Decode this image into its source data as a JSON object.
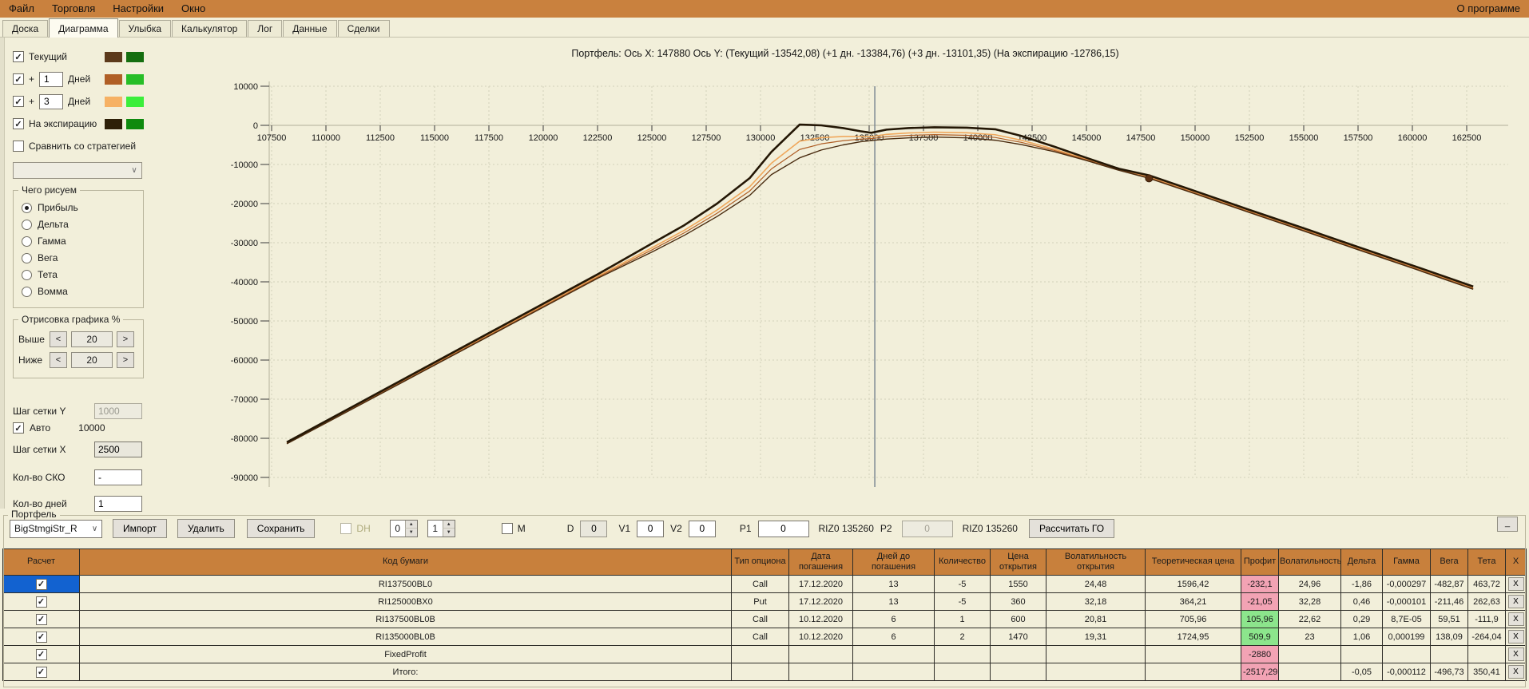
{
  "menu": {
    "items": [
      "Файл",
      "Торговля",
      "Настройки",
      "Окно"
    ],
    "about": "О программе"
  },
  "tabs": [
    "Доска",
    "Диаграмма",
    "Улыбка",
    "Калькулятор",
    "Лог",
    "Данные",
    "Сделки"
  ],
  "active_tab": "Диаграмма",
  "sidebar": {
    "plus_label": "+",
    "series_toggles": [
      {
        "label": "Текущий",
        "value": "",
        "swatch1": "#5C3A1B",
        "swatch2": "#156E0F"
      },
      {
        "label": "Дней",
        "value": "1",
        "swatch1": "#B05F26",
        "swatch2": "#27BE27"
      },
      {
        "label": "Дней",
        "value": "3",
        "swatch1": "#F6B164",
        "swatch2": "#3BEE3B"
      },
      {
        "label": "На экспирацию",
        "value": "",
        "swatch1": "#2E2008",
        "swatch2": "#0E8A0E"
      }
    ],
    "compare_label": "Сравнить со стратегией",
    "draw_group": {
      "title": "Чего рисуем",
      "options": [
        "Прибыль",
        "Дельта",
        "Гамма",
        "Вега",
        "Тета",
        "Вомма"
      ],
      "selected": "Прибыль"
    },
    "render_group": {
      "title": "Отрисовка графика %",
      "above_label": "Выше",
      "above": "20",
      "below_label": "Ниже",
      "below": "20",
      "dec": "<",
      "inc": ">"
    },
    "grid_y_label": "Шаг сетки Y",
    "grid_y": "1000",
    "auto_label": "Авто",
    "auto_value": "10000",
    "grid_x_label": "Шаг сетки X",
    "grid_x": "2500",
    "sko_label": "Кол-во СКО",
    "sko": "-",
    "days_label": "Кол-во дней",
    "days": "1"
  },
  "chart_data": {
    "type": "line",
    "title": "Портфель: Ось X: 147880 Ось Y:   (Текущий -13542,08)  (+1 дн. -13384,76)  (+3 дн. -13101,35)  (На экспирацию -12786,15)",
    "x_ticks": [
      107500,
      110000,
      112500,
      115000,
      117500,
      120000,
      122500,
      125000,
      127500,
      130000,
      132500,
      135000,
      137500,
      140000,
      142500,
      145000,
      147500,
      150000,
      152500,
      155000,
      157500,
      160000,
      162500
    ],
    "y_ticks": [
      10000,
      0,
      -10000,
      -20000,
      -30000,
      -40000,
      -50000,
      -60000,
      -70000,
      -80000,
      -90000
    ],
    "x_grid_step": 2500,
    "y_grid_step": 10000,
    "grid": true,
    "legend": false,
    "vline_x": 135260,
    "marker": {
      "x": 147880,
      "y": -13542
    },
    "x": [
      108200,
      110000,
      112500,
      115000,
      117500,
      120000,
      122500,
      125000,
      126500,
      128000,
      129500,
      130500,
      131800,
      132800,
      133800,
      134600,
      135100,
      135800,
      136800,
      138000,
      139500,
      140800,
      142000,
      143500,
      145000,
      146500,
      147880,
      150000,
      152500,
      155000,
      157500,
      160000,
      162800
    ],
    "series": [
      {
        "id": "plus3",
        "name": "+3 дн",
        "color": "#F0A85C",
        "width": 1.6,
        "y": [
          -81200,
          -75850,
          -68400,
          -60950,
          -53500,
          -46050,
          -38600,
          -31300,
          -26800,
          -21650,
          -15700,
          -9700,
          -4050,
          -3150,
          -2850,
          -2850,
          -2900,
          -2300,
          -1950,
          -1750,
          -1900,
          -2400,
          -3800,
          -6050,
          -8650,
          -11300,
          -13101,
          -17150,
          -21950,
          -26650,
          -31450,
          -36150,
          -41550
        ]
      },
      {
        "id": "plus1",
        "name": "+1 дн",
        "color": "#B05F26",
        "width": 1.2,
        "y": [
          -81300,
          -75975,
          -68550,
          -61125,
          -53700,
          -46275,
          -38850,
          -31850,
          -27450,
          -22475,
          -16800,
          -11150,
          -6175,
          -4725,
          -3925,
          -3525,
          -3400,
          -2900,
          -2575,
          -2375,
          -2550,
          -3100,
          -4350,
          -6375,
          -8825,
          -11400,
          -13385,
          -17325,
          -22125,
          -26825,
          -31625,
          -36325,
          -41725
        ]
      },
      {
        "id": "current",
        "name": "Текущий",
        "color": "#4A2C10",
        "width": 1.4,
        "y": [
          -81400,
          -76100,
          -68700,
          -61300,
          -53900,
          -46500,
          -39100,
          -32400,
          -28100,
          -23300,
          -17900,
          -12600,
          -8300,
          -6300,
          -5000,
          -4200,
          -3900,
          -3500,
          -3200,
          -3000,
          -3200,
          -3800,
          -4900,
          -6700,
          -9000,
          -11500,
          -13542,
          -17500,
          -22300,
          -27000,
          -31800,
          -36500,
          -41900
        ]
      },
      {
        "id": "expiration",
        "name": "На экспирацию",
        "color": "#241705",
        "width": 2.6,
        "y": [
          -81000,
          -75600,
          -68100,
          -60600,
          -53100,
          -45600,
          -38100,
          -30200,
          -25500,
          -20000,
          -13500,
          -6800,
          200,
          0,
          -700,
          -1500,
          -1900,
          -1100,
          -700,
          -500,
          -600,
          -1000,
          -2700,
          -5400,
          -8300,
          -11100,
          -12786,
          -16800,
          -21600,
          -26300,
          -31100,
          -35800,
          -41200
        ]
      }
    ]
  },
  "toolbar": {
    "group_label": "Портфель",
    "strategy_combo": "BigStmgiStr_R",
    "import": "Импорт",
    "delete": "Удалить",
    "save": "Сохранить",
    "dh_label": "DH",
    "spin1": "0",
    "spin2": "1",
    "m_label": "M",
    "d_label": "D",
    "d_value": "0",
    "v1_label": "V1",
    "v1_value": "0",
    "v2_label": "V2",
    "v2_value": "0",
    "p1_label": "P1",
    "p1_value": "0",
    "riz1": "RIZ0 135260",
    "p2_label": "P2",
    "p2_value": "0",
    "riz2": "RIZ0 135260",
    "calc_go": "Рассчитать ГО",
    "minimize": "_"
  },
  "table": {
    "columns": [
      "Расчет",
      "Код бумаги",
      "Тип опциона",
      "Дата погашения",
      "Дней до погашения",
      "Количество",
      "Цена открытия",
      "Волатильность открытия",
      "Теоретическая цена",
      "Профит",
      "Волатильность",
      "Дельта",
      "Гамма",
      "Вега",
      "Тета",
      "X"
    ],
    "row_action": "X",
    "rows": [
      {
        "selected": true,
        "checked": true,
        "code": "RI137500BL0",
        "type": "Call",
        "expiry": "17.12.2020",
        "days": "13",
        "qty": "-5",
        "open_price": "1550",
        "open_vol": "24,48",
        "theor": "1596,42",
        "profit": "-232,1",
        "profit_sign": "neg",
        "vol": "24,96",
        "delta": "-1,86",
        "gamma": "-0,000297",
        "vega": "-482,87",
        "theta": "463,72"
      },
      {
        "checked": true,
        "code": "RI125000BX0",
        "type": "Put",
        "expiry": "17.12.2020",
        "days": "13",
        "qty": "-5",
        "open_price": "360",
        "open_vol": "32,18",
        "theor": "364,21",
        "profit": "-21,05",
        "profit_sign": "neg",
        "vol": "32,28",
        "delta": "0,46",
        "gamma": "-0,000101",
        "vega": "-211,46",
        "theta": "262,63"
      },
      {
        "checked": true,
        "code": "RI137500BL0B",
        "type": "Call",
        "expiry": "10.12.2020",
        "days": "6",
        "qty": "1",
        "open_price": "600",
        "open_vol": "20,81",
        "theor": "705,96",
        "profit": "105,96",
        "profit_sign": "pos",
        "vol": "22,62",
        "delta": "0,29",
        "gamma": "8,7E-05",
        "vega": "59,51",
        "theta": "-111,9"
      },
      {
        "checked": true,
        "code": "RI135000BL0B",
        "type": "Call",
        "expiry": "10.12.2020",
        "days": "6",
        "qty": "2",
        "open_price": "1470",
        "open_vol": "19,31",
        "theor": "1724,95",
        "profit": "509,9",
        "profit_sign": "pos",
        "vol": "23",
        "delta": "1,06",
        "gamma": "0,000199",
        "vega": "138,09",
        "theta": "-264,04"
      },
      {
        "checked": true,
        "code": "FixedProfit",
        "type": "",
        "expiry": "",
        "days": "",
        "qty": "",
        "open_price": "",
        "open_vol": "",
        "theor": "",
        "profit": "-2880",
        "profit_sign": "neg",
        "vol": "",
        "delta": "",
        "gamma": "",
        "vega": "",
        "theta": ""
      },
      {
        "checked": true,
        "code": "Итого:",
        "type": "",
        "expiry": "",
        "days": "",
        "qty": "",
        "open_price": "",
        "open_vol": "",
        "theor": "",
        "profit": "-2517,29",
        "profit_sign": "neg",
        "vol": "",
        "delta": "-0,05",
        "gamma": "-0,000112",
        "vega": "-496,73",
        "theta": "350,41"
      }
    ]
  }
}
